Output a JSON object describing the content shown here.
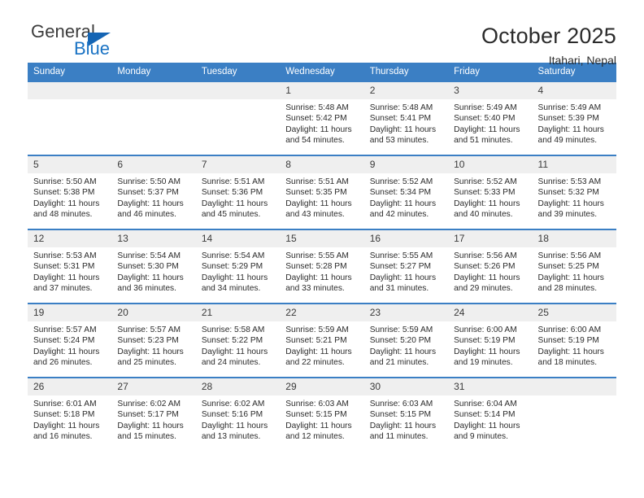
{
  "brand": {
    "name_top": "General",
    "name_bottom": "Blue",
    "triangle_icon": "blue-triangle-logo",
    "color": "#1a73c4"
  },
  "header": {
    "title": "October 2025",
    "subtitle": "Itahari, Nepal"
  },
  "calendar": {
    "header_bg": "#3b7fc4",
    "daynum_bg": "#efefef",
    "weekday_names": [
      "Sunday",
      "Monday",
      "Tuesday",
      "Wednesday",
      "Thursday",
      "Friday",
      "Saturday"
    ],
    "labels": {
      "sunrise": "Sunrise:",
      "sunset": "Sunset:",
      "daylight": "Daylight:"
    },
    "weeks": [
      [
        {
          "day": "",
          "empty": true
        },
        {
          "day": "",
          "empty": true
        },
        {
          "day": "",
          "empty": true
        },
        {
          "day": "1",
          "sunrise": "Sunrise: 5:48 AM",
          "sunset": "Sunset: 5:42 PM",
          "daylight_line1": "Daylight: 11 hours",
          "daylight_line2": "and 54 minutes."
        },
        {
          "day": "2",
          "sunrise": "Sunrise: 5:48 AM",
          "sunset": "Sunset: 5:41 PM",
          "daylight_line1": "Daylight: 11 hours",
          "daylight_line2": "and 53 minutes."
        },
        {
          "day": "3",
          "sunrise": "Sunrise: 5:49 AM",
          "sunset": "Sunset: 5:40 PM",
          "daylight_line1": "Daylight: 11 hours",
          "daylight_line2": "and 51 minutes."
        },
        {
          "day": "4",
          "sunrise": "Sunrise: 5:49 AM",
          "sunset": "Sunset: 5:39 PM",
          "daylight_line1": "Daylight: 11 hours",
          "daylight_line2": "and 49 minutes."
        }
      ],
      [
        {
          "day": "5",
          "sunrise": "Sunrise: 5:50 AM",
          "sunset": "Sunset: 5:38 PM",
          "daylight_line1": "Daylight: 11 hours",
          "daylight_line2": "and 48 minutes."
        },
        {
          "day": "6",
          "sunrise": "Sunrise: 5:50 AM",
          "sunset": "Sunset: 5:37 PM",
          "daylight_line1": "Daylight: 11 hours",
          "daylight_line2": "and 46 minutes."
        },
        {
          "day": "7",
          "sunrise": "Sunrise: 5:51 AM",
          "sunset": "Sunset: 5:36 PM",
          "daylight_line1": "Daylight: 11 hours",
          "daylight_line2": "and 45 minutes."
        },
        {
          "day": "8",
          "sunrise": "Sunrise: 5:51 AM",
          "sunset": "Sunset: 5:35 PM",
          "daylight_line1": "Daylight: 11 hours",
          "daylight_line2": "and 43 minutes."
        },
        {
          "day": "9",
          "sunrise": "Sunrise: 5:52 AM",
          "sunset": "Sunset: 5:34 PM",
          "daylight_line1": "Daylight: 11 hours",
          "daylight_line2": "and 42 minutes."
        },
        {
          "day": "10",
          "sunrise": "Sunrise: 5:52 AM",
          "sunset": "Sunset: 5:33 PM",
          "daylight_line1": "Daylight: 11 hours",
          "daylight_line2": "and 40 minutes."
        },
        {
          "day": "11",
          "sunrise": "Sunrise: 5:53 AM",
          "sunset": "Sunset: 5:32 PM",
          "daylight_line1": "Daylight: 11 hours",
          "daylight_line2": "and 39 minutes."
        }
      ],
      [
        {
          "day": "12",
          "sunrise": "Sunrise: 5:53 AM",
          "sunset": "Sunset: 5:31 PM",
          "daylight_line1": "Daylight: 11 hours",
          "daylight_line2": "and 37 minutes."
        },
        {
          "day": "13",
          "sunrise": "Sunrise: 5:54 AM",
          "sunset": "Sunset: 5:30 PM",
          "daylight_line1": "Daylight: 11 hours",
          "daylight_line2": "and 36 minutes."
        },
        {
          "day": "14",
          "sunrise": "Sunrise: 5:54 AM",
          "sunset": "Sunset: 5:29 PM",
          "daylight_line1": "Daylight: 11 hours",
          "daylight_line2": "and 34 minutes."
        },
        {
          "day": "15",
          "sunrise": "Sunrise: 5:55 AM",
          "sunset": "Sunset: 5:28 PM",
          "daylight_line1": "Daylight: 11 hours",
          "daylight_line2": "and 33 minutes."
        },
        {
          "day": "16",
          "sunrise": "Sunrise: 5:55 AM",
          "sunset": "Sunset: 5:27 PM",
          "daylight_line1": "Daylight: 11 hours",
          "daylight_line2": "and 31 minutes."
        },
        {
          "day": "17",
          "sunrise": "Sunrise: 5:56 AM",
          "sunset": "Sunset: 5:26 PM",
          "daylight_line1": "Daylight: 11 hours",
          "daylight_line2": "and 29 minutes."
        },
        {
          "day": "18",
          "sunrise": "Sunrise: 5:56 AM",
          "sunset": "Sunset: 5:25 PM",
          "daylight_line1": "Daylight: 11 hours",
          "daylight_line2": "and 28 minutes."
        }
      ],
      [
        {
          "day": "19",
          "sunrise": "Sunrise: 5:57 AM",
          "sunset": "Sunset: 5:24 PM",
          "daylight_line1": "Daylight: 11 hours",
          "daylight_line2": "and 26 minutes."
        },
        {
          "day": "20",
          "sunrise": "Sunrise: 5:57 AM",
          "sunset": "Sunset: 5:23 PM",
          "daylight_line1": "Daylight: 11 hours",
          "daylight_line2": "and 25 minutes."
        },
        {
          "day": "21",
          "sunrise": "Sunrise: 5:58 AM",
          "sunset": "Sunset: 5:22 PM",
          "daylight_line1": "Daylight: 11 hours",
          "daylight_line2": "and 24 minutes."
        },
        {
          "day": "22",
          "sunrise": "Sunrise: 5:59 AM",
          "sunset": "Sunset: 5:21 PM",
          "daylight_line1": "Daylight: 11 hours",
          "daylight_line2": "and 22 minutes."
        },
        {
          "day": "23",
          "sunrise": "Sunrise: 5:59 AM",
          "sunset": "Sunset: 5:20 PM",
          "daylight_line1": "Daylight: 11 hours",
          "daylight_line2": "and 21 minutes."
        },
        {
          "day": "24",
          "sunrise": "Sunrise: 6:00 AM",
          "sunset": "Sunset: 5:19 PM",
          "daylight_line1": "Daylight: 11 hours",
          "daylight_line2": "and 19 minutes."
        },
        {
          "day": "25",
          "sunrise": "Sunrise: 6:00 AM",
          "sunset": "Sunset: 5:19 PM",
          "daylight_line1": "Daylight: 11 hours",
          "daylight_line2": "and 18 minutes."
        }
      ],
      [
        {
          "day": "26",
          "sunrise": "Sunrise: 6:01 AM",
          "sunset": "Sunset: 5:18 PM",
          "daylight_line1": "Daylight: 11 hours",
          "daylight_line2": "and 16 minutes."
        },
        {
          "day": "27",
          "sunrise": "Sunrise: 6:02 AM",
          "sunset": "Sunset: 5:17 PM",
          "daylight_line1": "Daylight: 11 hours",
          "daylight_line2": "and 15 minutes."
        },
        {
          "day": "28",
          "sunrise": "Sunrise: 6:02 AM",
          "sunset": "Sunset: 5:16 PM",
          "daylight_line1": "Daylight: 11 hours",
          "daylight_line2": "and 13 minutes."
        },
        {
          "day": "29",
          "sunrise": "Sunrise: 6:03 AM",
          "sunset": "Sunset: 5:15 PM",
          "daylight_line1": "Daylight: 11 hours",
          "daylight_line2": "and 12 minutes."
        },
        {
          "day": "30",
          "sunrise": "Sunrise: 6:03 AM",
          "sunset": "Sunset: 5:15 PM",
          "daylight_line1": "Daylight: 11 hours",
          "daylight_line2": "and 11 minutes."
        },
        {
          "day": "31",
          "sunrise": "Sunrise: 6:04 AM",
          "sunset": "Sunset: 5:14 PM",
          "daylight_line1": "Daylight: 11 hours",
          "daylight_line2": "and 9 minutes."
        },
        {
          "day": "",
          "empty": true
        }
      ]
    ]
  }
}
